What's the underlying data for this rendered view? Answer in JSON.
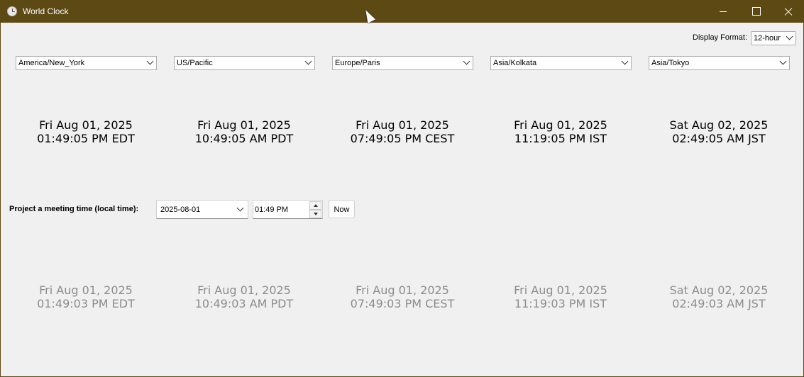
{
  "window": {
    "title": "World Clock",
    "icon": "clock-icon"
  },
  "display_format": {
    "label": "Display Format:",
    "value": "12-hour"
  },
  "timezones": [
    "America/New_York",
    "US/Pacific",
    "Europe/Paris",
    "Asia/Kolkata",
    "Asia/Tokyo"
  ],
  "clocks": [
    {
      "date": "Fri Aug 01, 2025",
      "time": "01:49:05 PM EDT"
    },
    {
      "date": "Fri Aug 01, 2025",
      "time": "10:49:05 AM PDT"
    },
    {
      "date": "Fri Aug 01, 2025",
      "time": "07:49:05 PM CEST"
    },
    {
      "date": "Fri Aug 01, 2025",
      "time": "11:19:05 PM IST"
    },
    {
      "date": "Sat Aug 02, 2025",
      "time": "02:49:05 AM JST"
    }
  ],
  "meeting": {
    "label": "Project a meeting time (local time):",
    "date": "2025-08-01",
    "time": "01:49 PM",
    "now_label": "Now"
  },
  "projected": [
    {
      "date": "Fri Aug 01, 2025",
      "time": "01:49:03 PM EDT"
    },
    {
      "date": "Fri Aug 01, 2025",
      "time": "10:49:03 AM PDT"
    },
    {
      "date": "Fri Aug 01, 2025",
      "time": "07:49:03 PM CEST"
    },
    {
      "date": "Fri Aug 01, 2025",
      "time": "11:19:03 PM IST"
    },
    {
      "date": "Sat Aug 02, 2025",
      "time": "02:49:03 AM JST"
    }
  ],
  "colors": {
    "titlebar": "#5d4914",
    "background": "#f0f0f0",
    "projected_text": "#8c8c8c"
  }
}
